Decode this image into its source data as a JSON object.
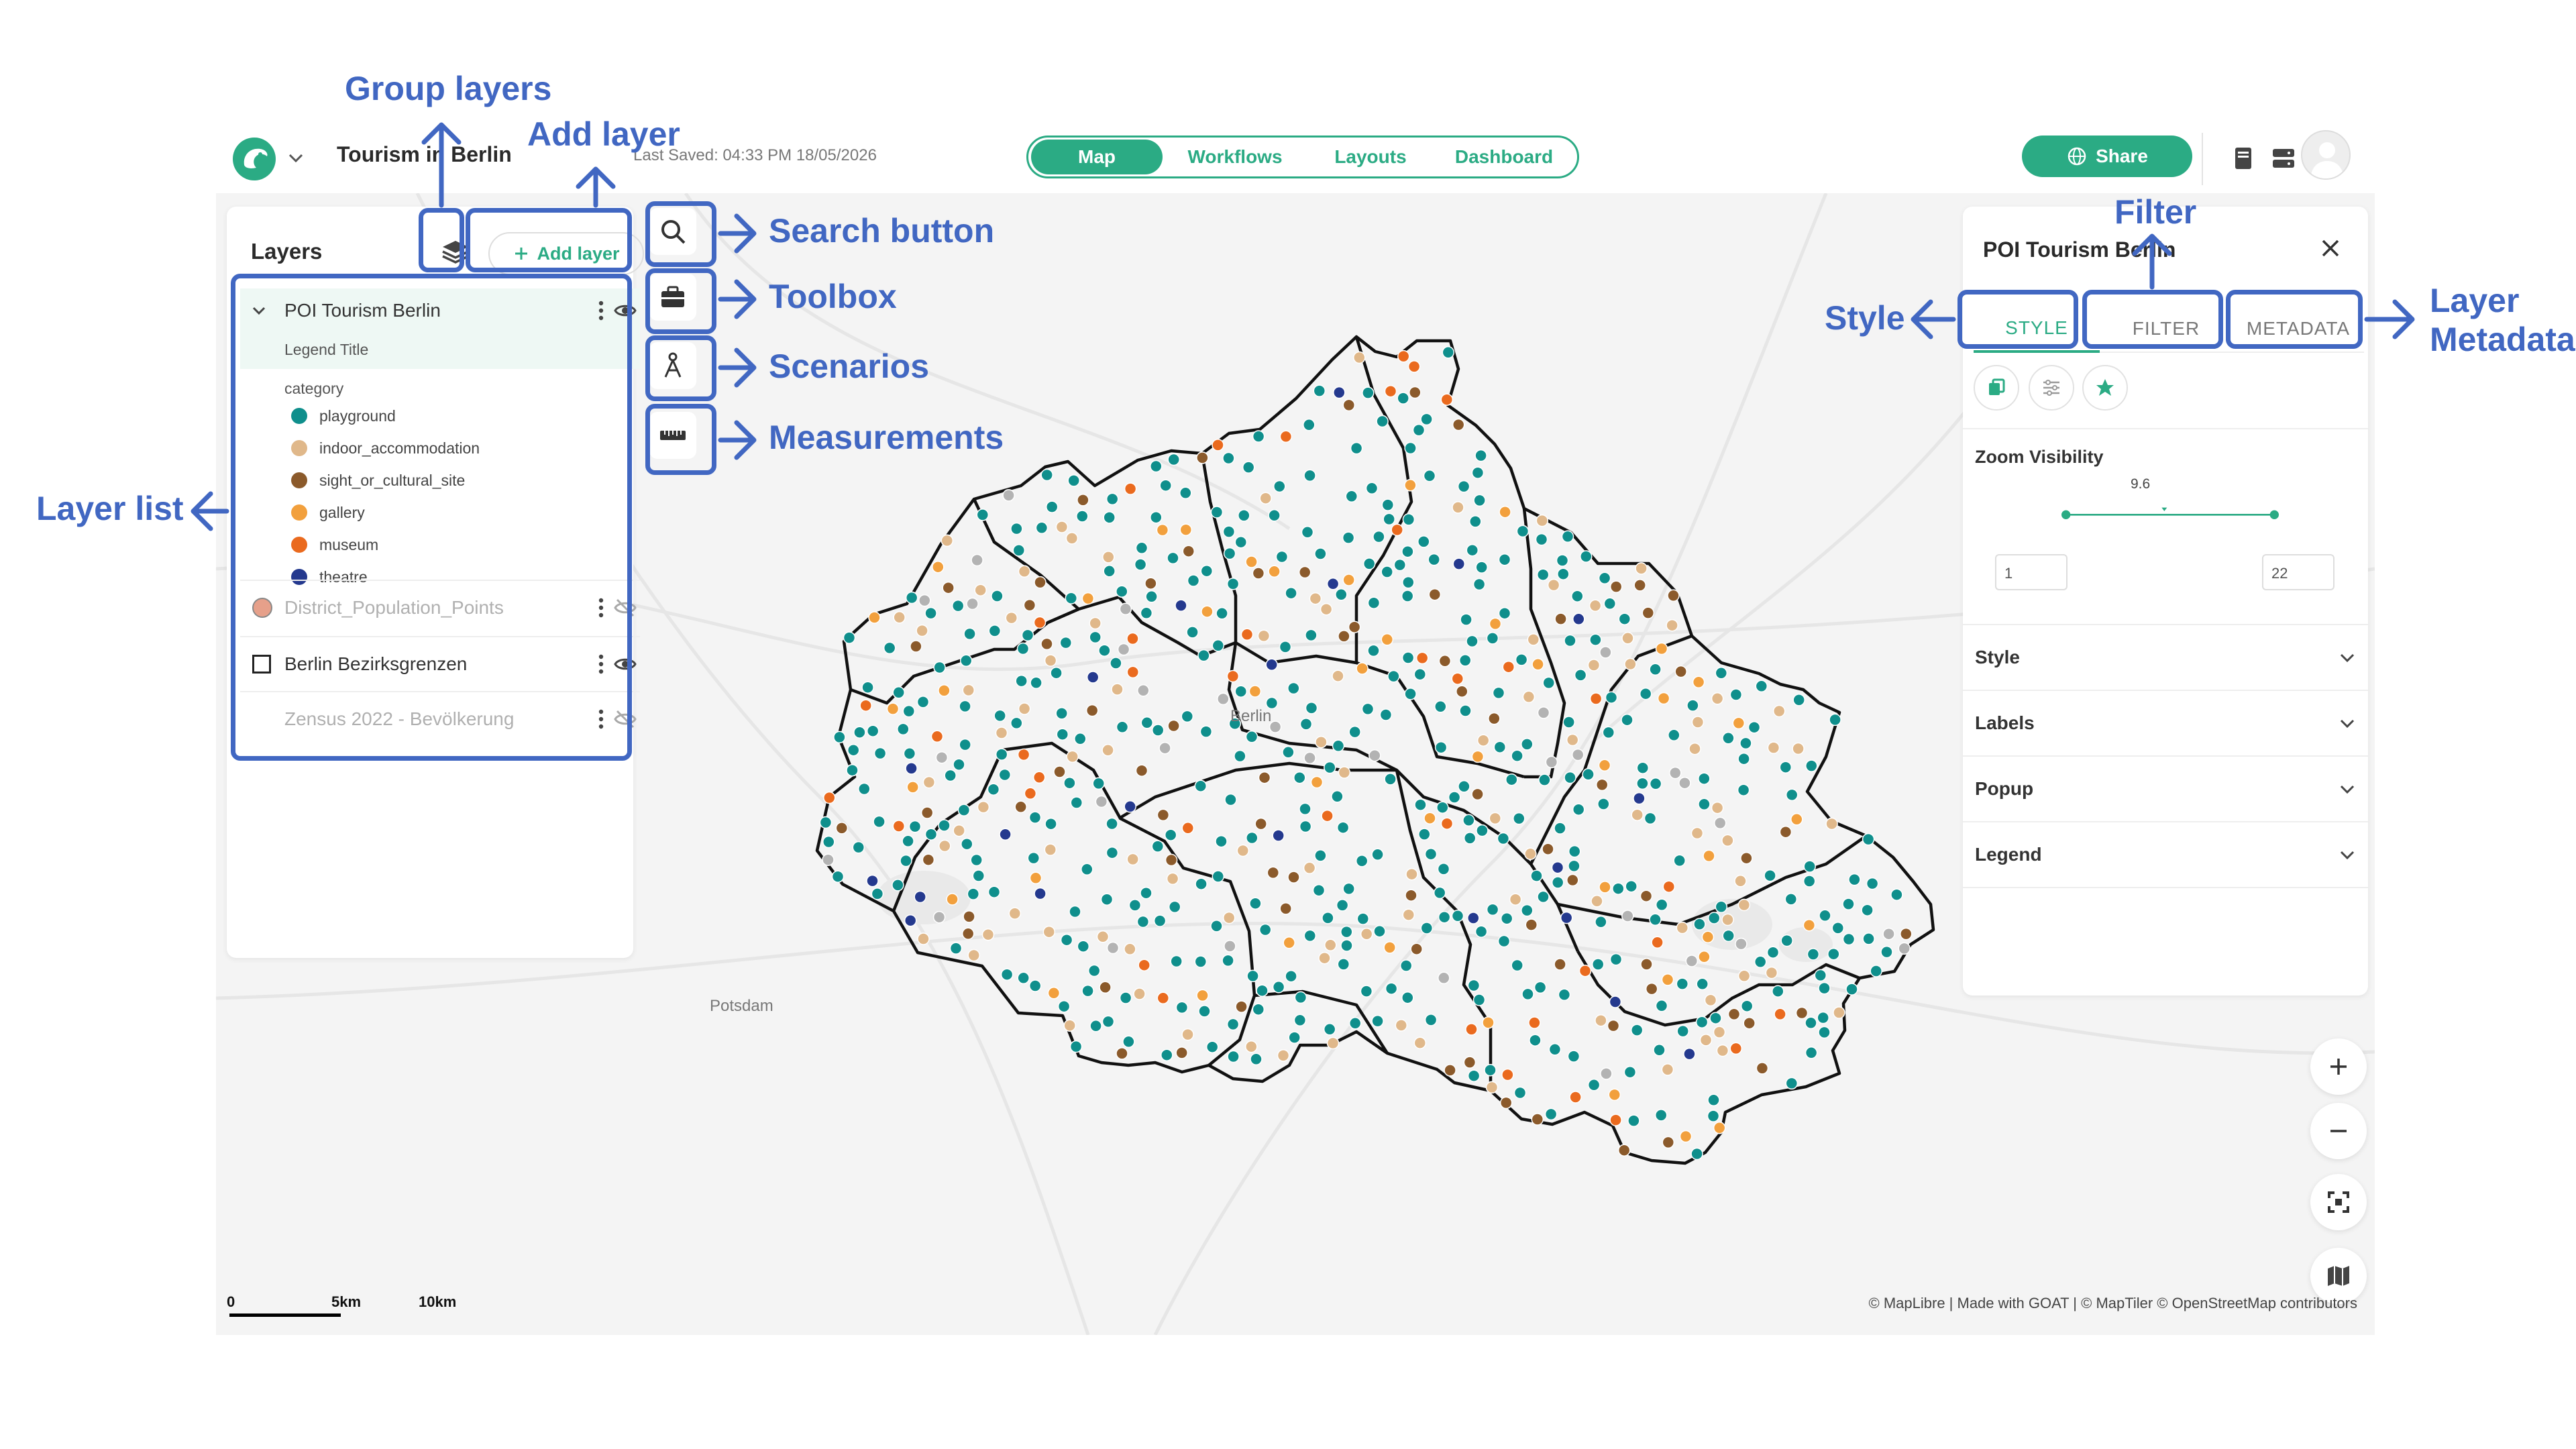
{
  "app": {
    "project_title": "Tourism in Berlin",
    "last_saved": "Last Saved: 04:33 PM 18/05/2026",
    "logo_icon": "goat-logo-icon",
    "accent_color": "#2bab84"
  },
  "nav": {
    "tabs": [
      {
        "label": "Map",
        "active": true
      },
      {
        "label": "Workflows",
        "active": false
      },
      {
        "label": "Layouts",
        "active": false
      },
      {
        "label": "Dashboard",
        "active": false
      }
    ]
  },
  "header_actions": {
    "share_label": "Share",
    "share_icon": "globe-icon"
  },
  "layers": {
    "title": "Layers",
    "add_layer_label": "Add layer",
    "items": [
      {
        "name": "POI Tourism Berlin",
        "visible": true,
        "expanded": true
      },
      {
        "name": "District_Population_Points",
        "visible": false
      },
      {
        "name": "Berlin Bezirksgrenzen",
        "visible": true
      },
      {
        "name": "Zensus 2022 - Bevölkerung",
        "visible": false
      }
    ],
    "legend": {
      "title": "Legend Title",
      "field": "category",
      "categories": [
        {
          "label": "playground",
          "color": "#0f8f8c"
        },
        {
          "label": "indoor_accommodation",
          "color": "#e0b88a"
        },
        {
          "label": "sight_or_cultural_site",
          "color": "#8b5a2b"
        },
        {
          "label": "gallery",
          "color": "#f2a03d"
        },
        {
          "label": "museum",
          "color": "#ea6a1e"
        },
        {
          "label": "theatre",
          "color": "#24398e"
        }
      ],
      "other_color": "#b3b3b3"
    }
  },
  "tools": [
    {
      "name": "search",
      "icon": "search-icon"
    },
    {
      "name": "toolbox",
      "icon": "toolbox-icon"
    },
    {
      "name": "scenarios",
      "icon": "scenario-icon"
    },
    {
      "name": "measurements",
      "icon": "ruler-icon"
    }
  ],
  "properties": {
    "title": "POI Tourism Berlin",
    "tabs": [
      {
        "label": "STYLE",
        "active": true
      },
      {
        "label": "FILTER",
        "active": false
      },
      {
        "label": "METADATA",
        "active": false
      }
    ],
    "zoom_visibility": {
      "label": "Zoom Visibility",
      "current": "9.6",
      "min": "1",
      "max": "22"
    },
    "sections": [
      "Style",
      "Labels",
      "Popup",
      "Legend"
    ]
  },
  "map": {
    "labels": {
      "city": "Berlin",
      "potsdam": "Potsdam"
    },
    "scale": {
      "zero": "0",
      "five": "5km",
      "ten": "10km"
    },
    "attribution": "© MapLibre | Made with GOAT | © MapTiler © OpenStreetMap contributors",
    "boundary_color": "#111111",
    "background_color": "#f4f4f4"
  },
  "annotations": {
    "group_layers": "Group layers",
    "add_layer": "Add layer",
    "search_button": "Search button",
    "toolbox": "Toolbox",
    "scenarios": "Scenarios",
    "measurements": "Measurements",
    "layer_list": "Layer list",
    "filter": "Filter",
    "style": "Style",
    "layer_metadata_1": "Layer",
    "layer_metadata_2": "Metadata",
    "color": "#4167c2"
  }
}
